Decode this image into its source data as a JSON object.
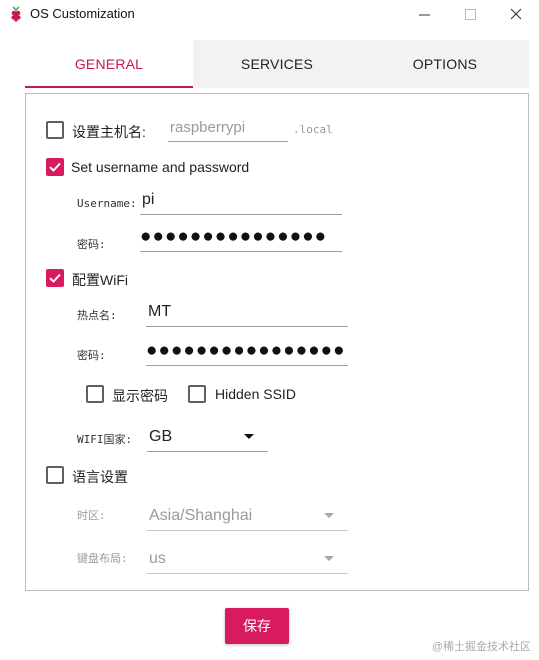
{
  "window": {
    "title": "OS Customization",
    "minimize_glyph": "—",
    "maximize_glyph": "☐",
    "close_glyph": "✕"
  },
  "tabs": [
    {
      "label": "GENERAL",
      "active": true
    },
    {
      "label": "SERVICES",
      "active": false
    },
    {
      "label": "OPTIONS",
      "active": false
    }
  ],
  "general": {
    "hostname": {
      "label": "设置主机名:",
      "checked": false,
      "value": "raspberrypi",
      "suffix": ".local"
    },
    "user": {
      "label": "Set username and password",
      "checked": true,
      "username_label": "Username:",
      "username_value": "pi",
      "password_label": "密码:",
      "password_mask": "●●●●●●●●●●●●●●●"
    },
    "wifi": {
      "label": "配置WiFi",
      "checked": true,
      "ssid_label": "热点名:",
      "ssid_value": "MT",
      "password_label": "密码:",
      "password_mask": "●●●●●●●●●●●●●●●●",
      "show_password_label": "显示密码",
      "show_password_checked": false,
      "hidden_ssid_label": "Hidden SSID",
      "hidden_ssid_checked": false,
      "country_label": "WIFI国家:",
      "country_value": "GB"
    },
    "locale": {
      "label": "语言设置",
      "checked": false,
      "timezone_label": "时区:",
      "timezone_value": "Asia/Shanghai",
      "keyboard_label": "键盘布局:",
      "keyboard_value": "us"
    }
  },
  "footer": {
    "save_label": "保存",
    "watermark": "@稀土掘金技术社区"
  },
  "colors": {
    "accent": "#d81b60",
    "tab_active_text": "#c51a4a",
    "tab_bar_bg": "#f2f2f2"
  }
}
